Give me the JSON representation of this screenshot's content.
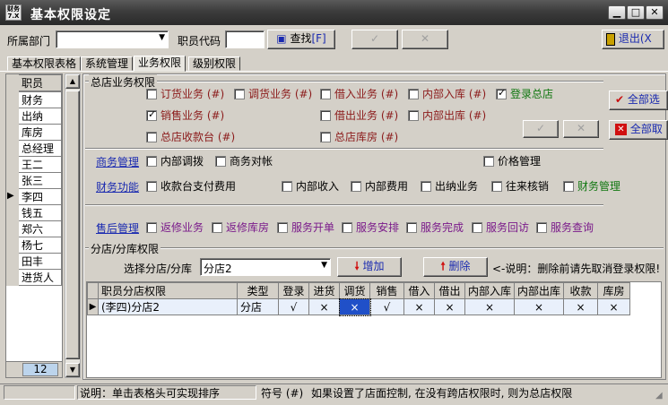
{
  "window": {
    "title": "基本权限设定",
    "app_icon_text": "财务\n7.X"
  },
  "header": {
    "dept_label": "所属部门",
    "dept_value": "",
    "staff_code_label": "职员代码",
    "staff_code_value": "",
    "find_label": "查找",
    "find_hotkey": "[F]",
    "confirm_glyph": "✓",
    "cancel_glyph": "✕",
    "exit_label": "退出(X"
  },
  "tabs": [
    "基本权限表格",
    "系统管理",
    "业务权限",
    "级别权限"
  ],
  "active_tab": 2,
  "employees": {
    "header": "职员",
    "items": [
      "财务",
      "出纳",
      "库房",
      "总经理",
      "王二",
      "张三",
      "李四",
      "钱五",
      "郑六",
      "杨七",
      "田丰",
      "进货人"
    ],
    "selected_index": 6,
    "count": "12"
  },
  "hq": {
    "group_title": "总店业务权限",
    "items": [
      {
        "label": "订货业务 (#)",
        "checked": false
      },
      {
        "label": "调货业务 (#)",
        "checked": false
      },
      {
        "label": "借入业务 (#)",
        "checked": false
      },
      {
        "label": "内部入库 (#)",
        "checked": false
      },
      {
        "label": "登录总店",
        "checked": true
      },
      {
        "label": "销售业务 (#)",
        "checked": true
      },
      {
        "label": "借出业务 (#)",
        "checked": false
      },
      {
        "label": "内部出库 (#)",
        "checked": false
      },
      {
        "label": "总店收款台 (#)",
        "checked": false
      },
      {
        "label": "总店库房 (#)",
        "checked": false
      }
    ],
    "select_all_label": "全部选",
    "clear_all_label": "全部取"
  },
  "business": {
    "label": "商务管理",
    "items": [
      {
        "label": "内部调拨",
        "checked": false
      },
      {
        "label": "商务对帐",
        "checked": false
      },
      {
        "label": "价格管理",
        "checked": false
      }
    ]
  },
  "finance": {
    "label": "财务功能",
    "items": [
      {
        "label": "收款台支付费用",
        "checked": false
      },
      {
        "label": "内部收入",
        "checked": false
      },
      {
        "label": "内部费用",
        "checked": false
      },
      {
        "label": "出纳业务",
        "checked": false
      },
      {
        "label": "往来核销",
        "checked": false
      },
      {
        "label": "财务管理",
        "checked": false
      }
    ]
  },
  "aftersale": {
    "label": "售后管理",
    "items": [
      {
        "label": "返修业务",
        "checked": false
      },
      {
        "label": "返修库房",
        "checked": false
      },
      {
        "label": "服务开单",
        "checked": false
      },
      {
        "label": "服务安排",
        "checked": false
      },
      {
        "label": "服务完成",
        "checked": false
      },
      {
        "label": "服务回访",
        "checked": false
      },
      {
        "label": "服务查询",
        "checked": false
      }
    ]
  },
  "branch": {
    "group_title": "分店/分库权限",
    "select_label": "选择分店/分库",
    "select_value": "分店2",
    "add_label": "增加",
    "delete_label": "删除",
    "note": "<-说明：删除前请先取消登录权限!",
    "columns": [
      "职员分店权限",
      "类型",
      "登录",
      "进货",
      "调货",
      "销售",
      "借入",
      "借出",
      "内部入库",
      "内部出库",
      "收款",
      "库房"
    ],
    "rows": [
      [
        "(李四)分店2",
        "分店",
        "√",
        "×",
        "×",
        "√",
        "×",
        "×",
        "×",
        "×",
        "×",
        "×"
      ]
    ]
  },
  "status": {
    "hint": "说明：单击表格头可实现排序",
    "symbol": "符号 (#)",
    "note": "如果设置了店面控制, 在没有跨店权限时, 则为总店权限"
  },
  "colors": {
    "title_bar": "#3c3c3c",
    "window_bg": "#d4d0c8",
    "module_link": "#1a2ab0",
    "red_text": "#8b1a1a",
    "purple_text": "#7a1a8a",
    "green_text": "#117711",
    "selected_cell": "#2050c8"
  }
}
